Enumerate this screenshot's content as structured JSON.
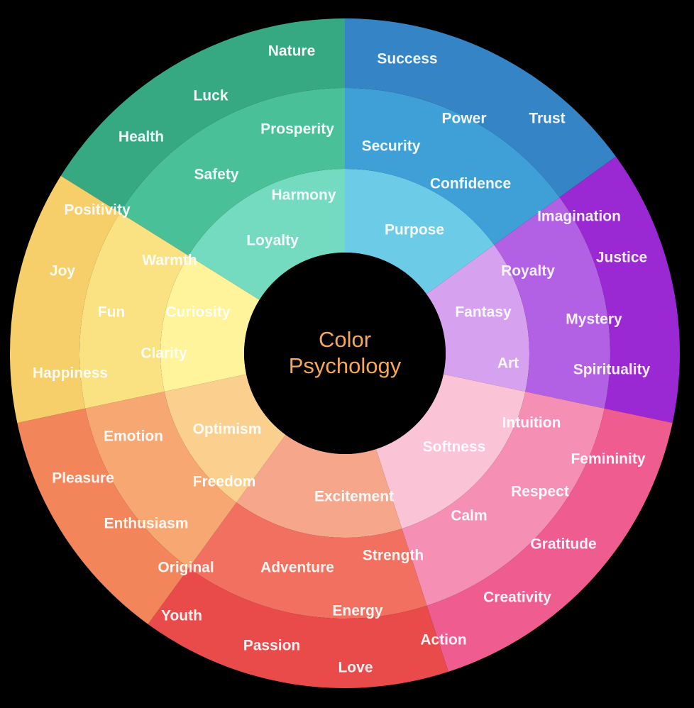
{
  "center": {
    "title_line1": "Color",
    "title_line2": "Psychology"
  },
  "colors": {
    "background": "#000000",
    "hub": "#000000",
    "center_text": "#f4a85a",
    "label_text": "#ffffff"
  },
  "segments": [
    {
      "name": "green",
      "colors": {
        "outer": "#37a982",
        "middle": "#49c097",
        "inner": "#74dbc1"
      },
      "labels": {
        "outer": [
          "Nature",
          "Luck",
          "Health"
        ],
        "middle": [
          "Prosperity",
          "Safety"
        ],
        "inner": [
          "Harmony",
          "Loyalty"
        ]
      }
    },
    {
      "name": "blue",
      "colors": {
        "outer": "#3484c6",
        "middle": "#3ea0d6",
        "inner": "#6ccbe6"
      },
      "labels": {
        "outer": [
          "Success",
          "Trust"
        ],
        "middle": [
          "Power",
          "Security",
          "Confidence"
        ],
        "inner": [
          "Purpose"
        ]
      }
    },
    {
      "name": "purple",
      "colors": {
        "outer": "#9a28d3",
        "middle": "#b260e4",
        "inner": "#d6a2f0"
      },
      "labels": {
        "outer": [
          "Imagination",
          "Justice",
          "Mystery",
          "Spirituality"
        ],
        "middle": [
          "Royalty"
        ],
        "inner": [
          "Fantasy",
          "Art"
        ]
      }
    },
    {
      "name": "pink",
      "colors": {
        "outer": "#ef5c8f",
        "middle": "#f58fb4",
        "inner": "#fbc3d6"
      },
      "labels": {
        "outer": [
          "Femininity",
          "Gratitude",
          "Creativity"
        ],
        "middle": [
          "Intuition",
          "Respect",
          "Calm"
        ],
        "inner": [
          "Softness"
        ]
      }
    },
    {
      "name": "red",
      "colors": {
        "outer": "#e94b4b",
        "middle": "#f27060",
        "inner": "#f6a68a"
      },
      "labels": {
        "outer": [
          "Passion",
          "Love",
          "Action"
        ],
        "middle": [
          "Adventure",
          "Strength",
          "Energy"
        ],
        "inner": [
          "Excitement"
        ]
      }
    },
    {
      "name": "orange",
      "colors": {
        "outer": "#f2855a",
        "middle": "#f7a772",
        "inner": "#fbd08e"
      },
      "labels": {
        "outer": [
          "Pleasure",
          "Enthusiasm",
          "Youth"
        ],
        "middle": [
          "Emotion",
          "Original"
        ],
        "inner": [
          "Optimism",
          "Freedom"
        ]
      }
    },
    {
      "name": "yellow",
      "colors": {
        "outer": "#f7cf6a",
        "middle": "#fae182",
        "inner": "#fff39c"
      },
      "labels": {
        "outer": [
          "Positivity",
          "Joy",
          "Happiness"
        ],
        "middle": [
          "Warmth",
          "Fun",
          "Clarity"
        ],
        "inner": [
          "Curiosity"
        ]
      }
    }
  ]
}
